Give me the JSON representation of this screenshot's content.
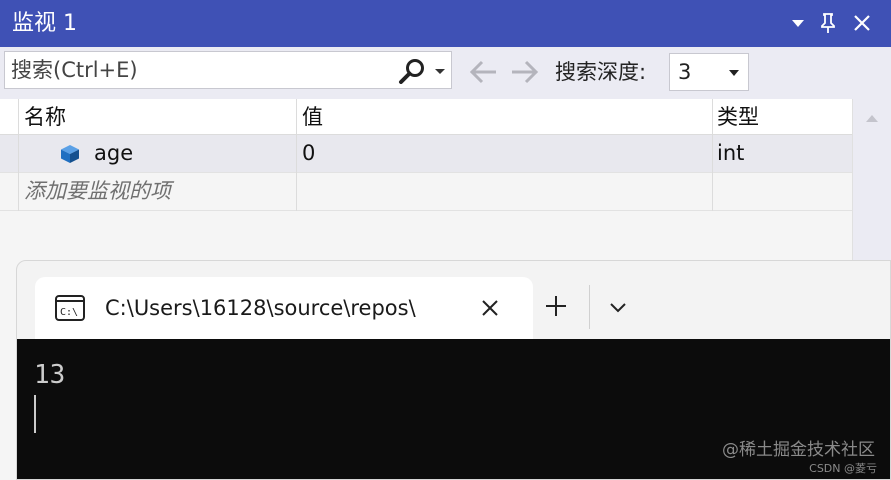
{
  "watch": {
    "title": "监视 1",
    "search": {
      "placeholder": "搜索(Ctrl+E)"
    },
    "depth": {
      "label": "搜索深度:",
      "value": "3"
    },
    "columns": {
      "name": "名称",
      "value": "值",
      "type": "类型"
    },
    "rows": [
      {
        "name": "age",
        "value": "0",
        "type": "int",
        "icon": "variable-cube-icon"
      }
    ],
    "add_placeholder": "添加要监视的项"
  },
  "terminal": {
    "tab_title": "C:\\Users\\16128\\source\\repos\\",
    "output": "13",
    "icon_text": "C:\\"
  },
  "watermark": {
    "line1": "@稀土掘金技术社区",
    "line2": "CSDN @菱亏"
  },
  "colors": {
    "titlebar": "#3f51b5",
    "cube": "#1f6fc1",
    "console_bg": "#0c0c0c"
  }
}
